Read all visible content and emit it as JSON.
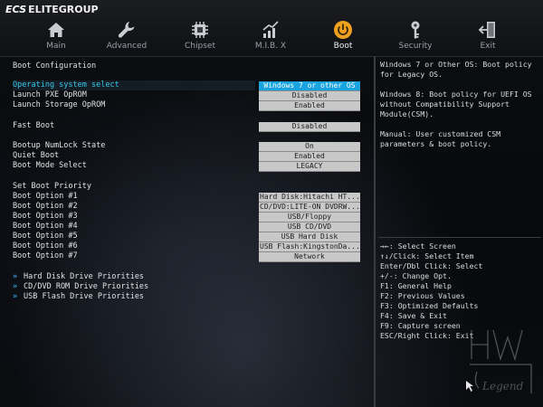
{
  "brand": {
    "ecs": "ECS",
    "name": "ELITEGROUP"
  },
  "tabs": [
    {
      "label": "Main",
      "icon": "home-icon"
    },
    {
      "label": "Advanced",
      "icon": "wrench-icon"
    },
    {
      "label": "Chipset",
      "icon": "chip-icon"
    },
    {
      "label": "M.I.B. X",
      "icon": "chart-icon"
    },
    {
      "label": "Boot",
      "icon": "power-icon",
      "active": true
    },
    {
      "label": "Security",
      "icon": "key-icon"
    },
    {
      "label": "Exit",
      "icon": "exit-icon"
    }
  ],
  "boot": {
    "section_title": "Boot Configuration",
    "os_select": {
      "label": "Operating system select",
      "value": "Windows 7 or other OS"
    },
    "pxe": {
      "label": "Launch PXE OpROM",
      "value": "Disabled"
    },
    "storage": {
      "label": "Launch Storage OpROM",
      "value": "Enabled"
    },
    "fast_boot": {
      "label": "Fast Boot",
      "value": "Disabled"
    },
    "numlock": {
      "label": "Bootup NumLock State",
      "value": "On"
    },
    "quiet": {
      "label": "Quiet Boot",
      "value": "Enabled"
    },
    "mode": {
      "label": "Boot Mode Select",
      "value": "LEGACY"
    },
    "priority_title": "Set Boot Priority",
    "options": [
      {
        "label": "Boot Option #1",
        "value": "Hard Disk:Hitachi HT..."
      },
      {
        "label": "Boot Option #2",
        "value": "CD/DVD:LITE-ON DVDRW..."
      },
      {
        "label": "Boot Option #3",
        "value": "USB/Floppy"
      },
      {
        "label": "Boot Option #4",
        "value": "USB CD/DVD"
      },
      {
        "label": "Boot Option #5",
        "value": "USB Hard Disk"
      },
      {
        "label": "Boot Option #6",
        "value": "USB Flash:KingstonDa..."
      },
      {
        "label": "Boot Option #7",
        "value": "Network"
      }
    ],
    "submenus": [
      "Hard Disk Drive Priorities",
      "CD/DVD ROM Drive Priorities",
      "USB Flash Drive Priorities"
    ]
  },
  "help": {
    "text": "Windows 7 or Other OS: Boot policy\nfor Legacy OS.\n\nWindows 8: Boot policy for UEFI OS\nwithout Compatibility Support\nModule(CSM).\n\nManual: User customized CSM\nparameters & boot policy."
  },
  "keys": [
    "→←: Select Screen",
    "↑↓/Click: Select Item",
    "Enter/Dbl Click: Select",
    "+/-: Change Opt.",
    "F1: General Help",
    "F2: Previous Values",
    "F3: Optimized Defaults",
    "F4: Save & Exit",
    "F9: Capture screen",
    "ESC/Right Click: Exit"
  ],
  "colors": {
    "accent": "#1aa4df",
    "selected_label": "#36c9e6",
    "active_icon": "#f0a020"
  }
}
